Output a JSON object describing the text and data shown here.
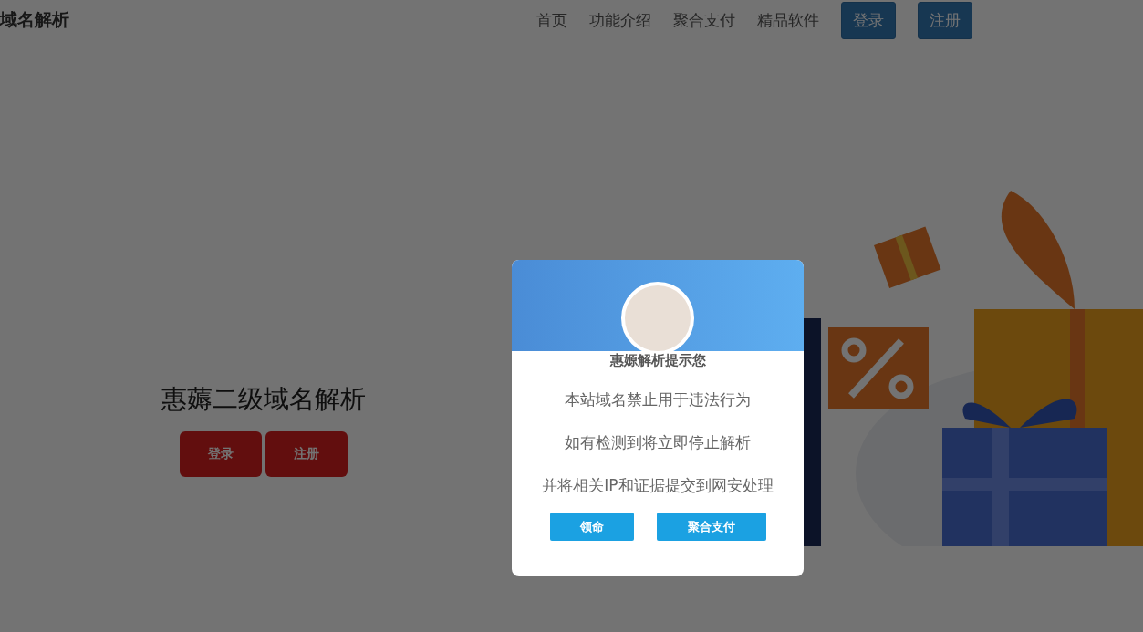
{
  "header": {
    "logo": "域名解析",
    "nav": [
      {
        "label": "首页",
        "kind": "link"
      },
      {
        "label": "功能介绍",
        "kind": "link"
      },
      {
        "label": "聚合支付",
        "kind": "link"
      },
      {
        "label": "精品软件",
        "kind": "link"
      },
      {
        "label": "登录",
        "kind": "button"
      },
      {
        "label": "注册",
        "kind": "button"
      }
    ]
  },
  "hero": {
    "title": "惠薅二级域名解析",
    "buttons": [
      "登录",
      "注册"
    ]
  },
  "modal": {
    "title": "惠嫄解析提示您",
    "lines": [
      "本站域名禁止用于违法行为",
      "如有检测到将立即停止解析",
      "并将相关IP和证据提交到网安处理"
    ],
    "buttons": [
      "领命",
      "聚合支付"
    ]
  }
}
